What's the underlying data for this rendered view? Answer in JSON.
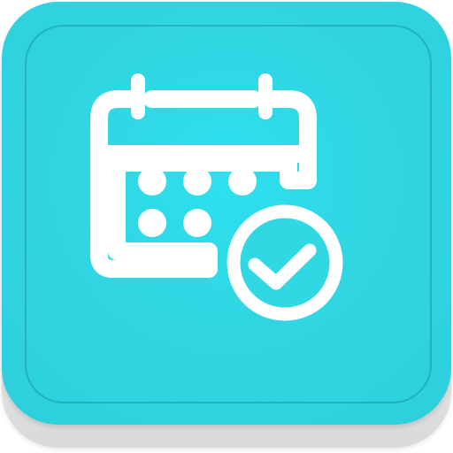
{
  "app_icon": {
    "icon": "calendar-check-icon",
    "colors": {
      "face": "#30d4e0",
      "base": "#e9e9e9",
      "glyph": "#ffffff"
    }
  }
}
